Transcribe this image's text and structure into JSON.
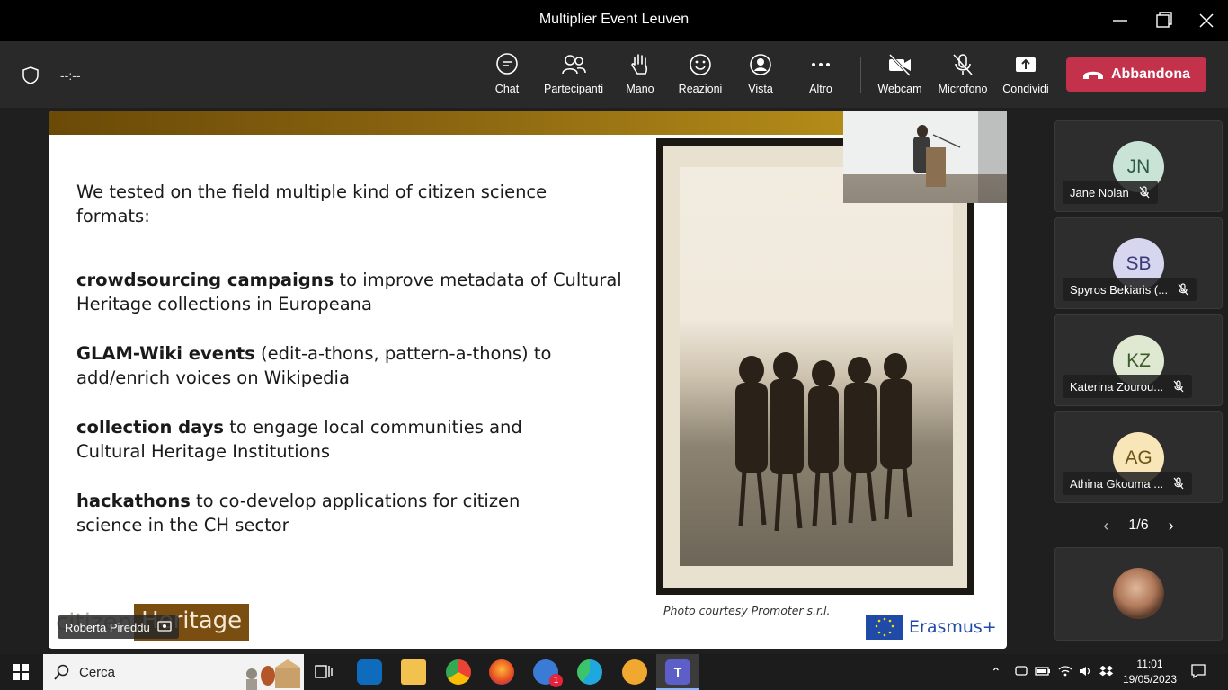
{
  "window": {
    "title": "Multiplier Event Leuven"
  },
  "meeting": {
    "timer": "--:--"
  },
  "toolbar": {
    "items": [
      {
        "label": "Chat",
        "icon": "chat-icon"
      },
      {
        "label": "Partecipanti",
        "icon": "people-icon"
      },
      {
        "label": "Mano",
        "icon": "hand-icon"
      },
      {
        "label": "Reazioni",
        "icon": "smiley-icon"
      },
      {
        "label": "Vista",
        "icon": "view-icon"
      },
      {
        "label": "Altro",
        "icon": "more-icon"
      },
      {
        "label": "Webcam",
        "icon": "camera-off-icon"
      },
      {
        "label": "Microfono",
        "icon": "mic-off-icon"
      },
      {
        "label": "Condividi",
        "icon": "share-icon"
      }
    ],
    "leave_label": "Abbandona",
    "leave_color": "#c4314b"
  },
  "slide": {
    "intro": "We tested on the field multiple kind of citizen science formats:",
    "points": [
      {
        "bold": "crowdsourcing campaigns",
        "rest": " to improve metadata of Cultural Heritage collections in Europeana"
      },
      {
        "bold": "GLAM-Wiki events",
        "rest": " (edit-a-thons, pattern-a-thons) to add/enrich voices on Wikipedia"
      },
      {
        "bold": "collection days",
        "rest": " to engage local communities and Cultural Heritage Institutions"
      },
      {
        "bold": "hackathons",
        "rest": " to co-develop applications for citizen science in the CH sector"
      }
    ],
    "caption": "Photo courtesy Promoter s.r.l.",
    "logo_left": "citizen",
    "logo_right": "Heritage",
    "erasmus": "Erasmus+"
  },
  "presenter": {
    "name": "Roberta Pireddu"
  },
  "participants": [
    {
      "initials": "JN",
      "name": "Jane Nolan",
      "color": "#c9e3d6",
      "text_color": "#2d5a46"
    },
    {
      "initials": "SB",
      "name": "Spyros Bekiaris (...",
      "color": "#d7d6ef",
      "text_color": "#3b3a78"
    },
    {
      "initials": "KZ",
      "name": "Katerina Zourou...",
      "color": "#dfe9d2",
      "text_color": "#3e5a2c"
    },
    {
      "initials": "AG",
      "name": "Athina Gkouma ...",
      "color": "#f8e6b8",
      "text_color": "#6c5418"
    }
  ],
  "pager": {
    "text": "1/6"
  },
  "taskbar": {
    "search_placeholder": "Cerca",
    "time": "11:01",
    "date": "19/05/2023",
    "mail_badge": "1"
  }
}
